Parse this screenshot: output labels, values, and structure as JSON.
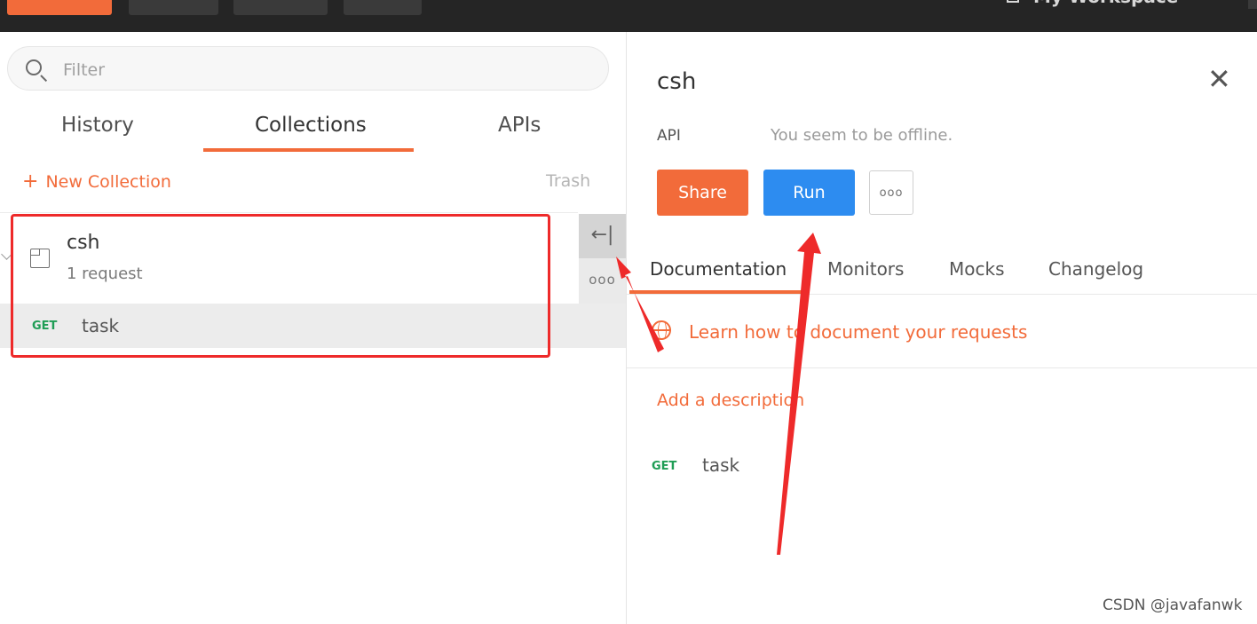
{
  "topbar": {
    "workspace_label": "My Workspace"
  },
  "sidebar": {
    "search_placeholder": "Filter",
    "tabs": [
      "History",
      "Collections",
      "APIs"
    ],
    "active_tab": "Collections",
    "new_collection_label": "New Collection",
    "trash_label": "Trash",
    "collection": {
      "name": "csh",
      "count": "1 request",
      "requests": [
        {
          "method": "GET",
          "name": "task"
        }
      ]
    }
  },
  "detail": {
    "title": "csh",
    "type": "API",
    "status": "You seem to be offline.",
    "share_label": "Share",
    "run_label": "Run",
    "tabs": [
      "Documentation",
      "Monitors",
      "Mocks",
      "Changelog"
    ],
    "active_tab": "Documentation",
    "learn_link": "Learn how to document your requests",
    "add_description": "Add a description",
    "requests": [
      {
        "method": "GET",
        "name": "task"
      }
    ]
  },
  "watermark": "CSDN @javafanwk",
  "colors": {
    "brand_orange": "#f26b3a",
    "run_blue": "#2d8cf0",
    "get_green": "#1f9d55",
    "annotation_red": "#ee2a2a"
  }
}
